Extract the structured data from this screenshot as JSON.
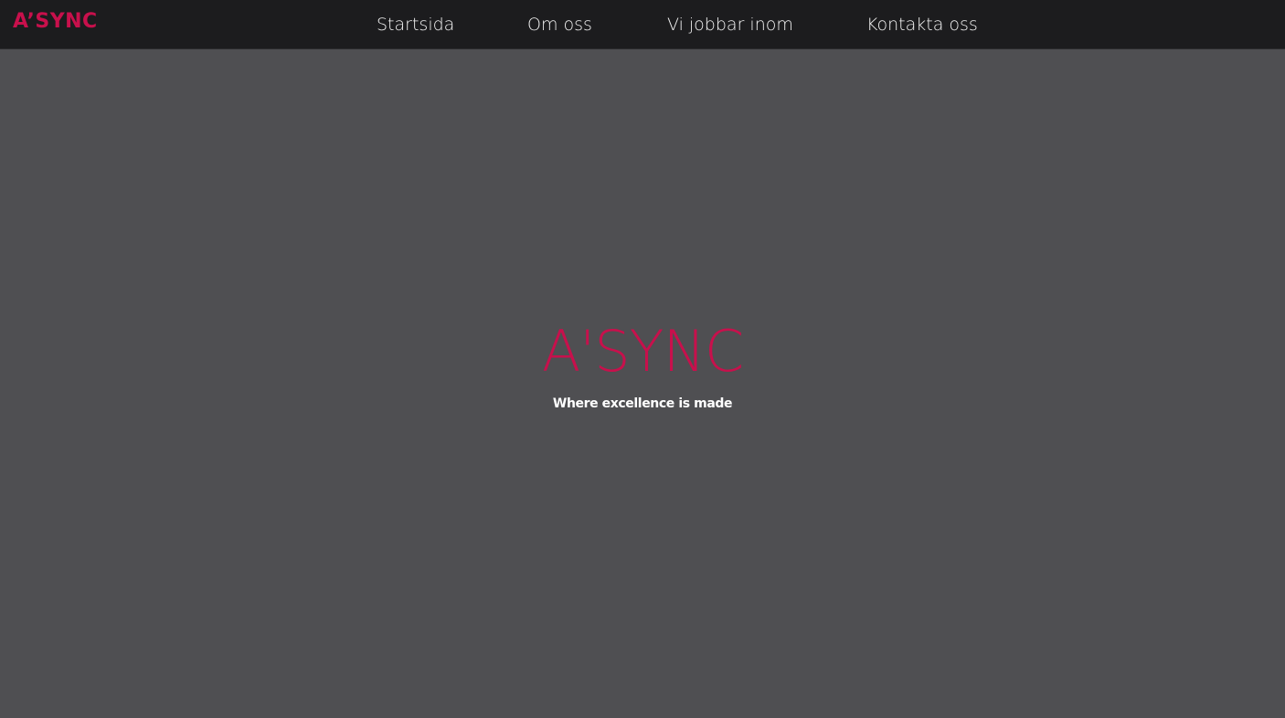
{
  "header": {
    "brand": "A’SYNC",
    "nav": [
      {
        "label": "Startsida"
      },
      {
        "label": "Om oss"
      },
      {
        "label": "Vi jobbar inom"
      },
      {
        "label": "Kontakta oss"
      }
    ]
  },
  "hero": {
    "title": "A'SYNC",
    "tagline": "Where excellence is made"
  },
  "colors": {
    "accent": "#c8104c",
    "nav_background": "#1c1c1e",
    "page_background": "#4f4f52",
    "text": "#ffffff"
  }
}
